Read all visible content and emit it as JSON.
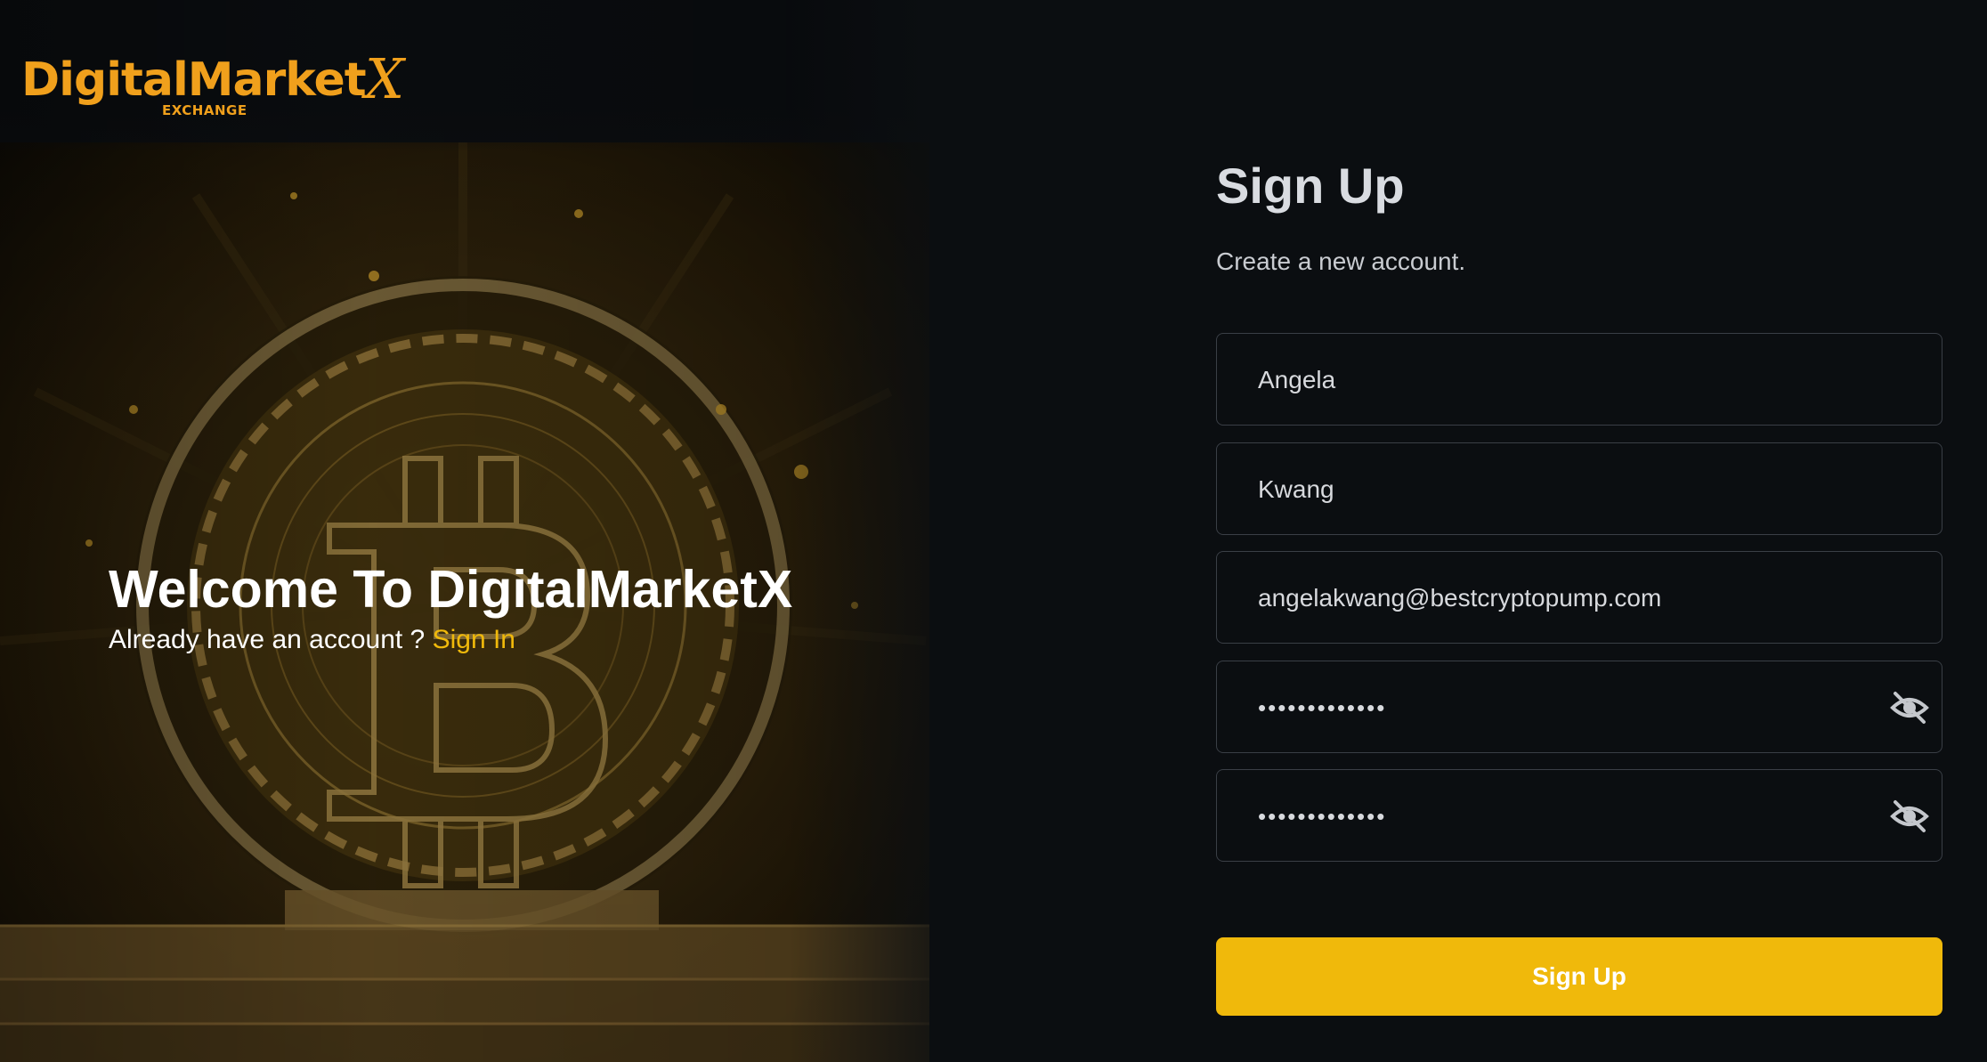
{
  "brand": {
    "logo_text": "DigitalMarket",
    "logo_x": "X",
    "logo_sub": "EXCHANGE",
    "accent_color": "#f0b90b",
    "logo_color": "#f0a01c"
  },
  "hero": {
    "title": "Welcome To DigitalMarketX",
    "prompt": "Already have an account ?",
    "signin_link": "Sign In"
  },
  "form": {
    "title": "Sign Up",
    "subtitle": "Create a new account.",
    "fields": [
      {
        "name": "first-name",
        "value": "Angela"
      },
      {
        "name": "last-name",
        "value": "Kwang"
      },
      {
        "name": "email",
        "value": "angelakwang@bestcryptopump.com"
      },
      {
        "name": "password",
        "value": "•••••••••••••",
        "icon": "eye-off-icon"
      },
      {
        "name": "confirm-password",
        "value": "•••••••••••••",
        "icon": "eye-off-icon"
      }
    ],
    "submit_label": "Sign Up"
  }
}
